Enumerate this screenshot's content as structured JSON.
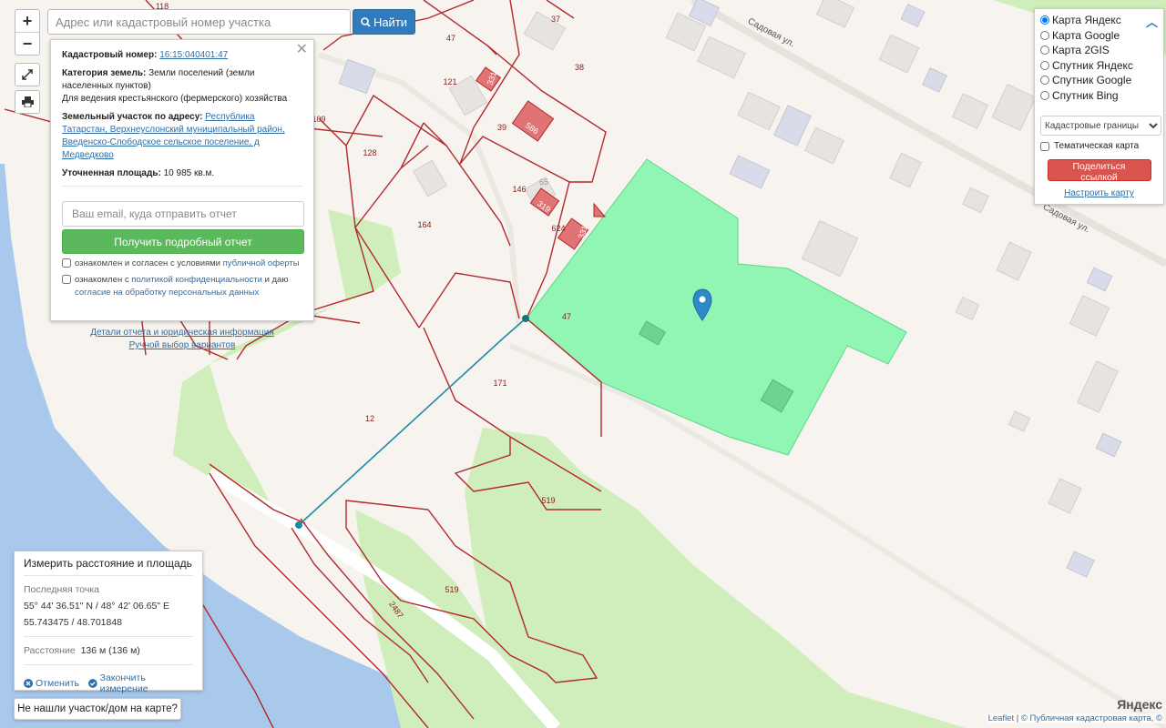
{
  "search": {
    "placeholder": "Адрес или кадастровый номер участка",
    "button_label": "Найти"
  },
  "zoom": {
    "in_label": "+",
    "out_label": "−"
  },
  "popup": {
    "cadastral_label": "Кадастровый номер:",
    "cadastral_value": "16:15:040401:47",
    "category_label": "Категория земель:",
    "category_value": "Земли поселений (земли населенных пунктов)",
    "usage_value": "Для ведения крестьянского (фермерского) хозяйства",
    "address_label": "Земельный участок по адресу:",
    "address_value": "Республика Татарстан, Верхнеуслонский муниципальный район, Введенско-Слободское сельское поселение, д Медведково",
    "area_label": "Уточненная площадь:",
    "area_value": "10 985 кв.м.",
    "email_placeholder": "Ваш email, куда отправить отчет",
    "report_button": "Получить подробный отчет",
    "check1_prefix": "ознакомлен и согласен с условиями",
    "check1_link": "публичной оферты",
    "check2_prefix": "ознакомлен с",
    "check2_link1": "политикой конфиденциальности",
    "check2_mid": "и даю",
    "check2_link2": "согласие на обработку персональных данных",
    "details_link": "Детали отчета и юридическая информация",
    "manual_link": "Ручной выбор вариантов"
  },
  "layers": {
    "options": [
      "Карта Яндекс",
      "Карта Google",
      "Карта 2GIS",
      "Спутник Яндекс",
      "Спутник Google",
      "Спутник Bing"
    ],
    "selected_index": 0,
    "overlay_select": "Кадастровые границы",
    "thematic_label": "Тематическая карта",
    "share_button": "Поделиться ссылкой",
    "config_link": "Настроить карту"
  },
  "measure": {
    "title": "Измерить расстояние и площадь",
    "last_point_label": "Последняя точка",
    "coords_dms": "55° 44' 36.51\" N / 48° 42' 06.65\" E",
    "coords_dec": "55.743475 / 48.701848",
    "distance_label": "Расстояние",
    "distance_value": "136 м (136 м)",
    "cancel_label": "Отменить",
    "finish_label": "Закончить измерение"
  },
  "not_found_label": "Не нашли участок/дом на карте?",
  "attribution": {
    "leaflet": "Leaflet",
    "sep": "|",
    "cadastral": "© Публичная кадастровая карта, ©"
  },
  "yandex_logo": "Яндекс",
  "street_labels": [
    "Садовая ул.",
    "Садовая ул."
  ],
  "parcel_labels": [
    "118",
    "37",
    "47",
    "38",
    "121",
    "331",
    "39",
    "586",
    "109",
    "128",
    "65",
    "146",
    "319",
    "624",
    "331",
    "164",
    "47",
    "171",
    "12",
    "519",
    "519",
    "2487"
  ],
  "colors": {
    "parcel_border": "#b3282d",
    "selected_fill": "#7ff5a8",
    "water": "#a8c8ec",
    "greenery": "#cfeebc",
    "measure_line": "#1b8aa6",
    "search_button": "#2f7bbd",
    "report_button": "#5cb85c",
    "share_button": "#d9534f"
  }
}
